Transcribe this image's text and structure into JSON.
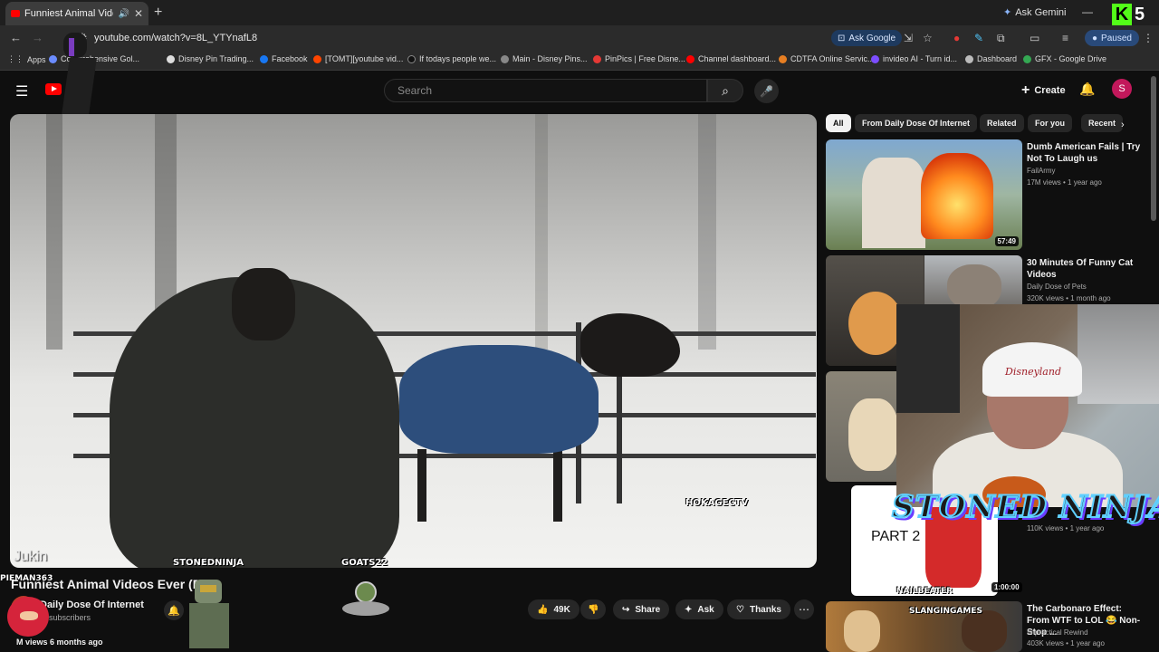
{
  "browser": {
    "tab_title": "Funniest Animal Videos Eve",
    "new_tab": "+",
    "ask_gemini": "Ask Gemini",
    "url": "youtube.com/watch?v=8L_YTYnafL8",
    "ask_google": "Ask Google",
    "profile_status": "Paused",
    "kick_number": "5",
    "bookmarks": [
      "Apps",
      "Comprehensive Gol...",
      "Disney Pin Trading...",
      "Facebook",
      "[TOMT][youtube vid...",
      "If todays people we...",
      "Main - Disney Pins...",
      "PinPics | Free Disne...",
      "Channel dashboard...",
      "CDTFA Online Servic...",
      "invideo AI - Turn id...",
      "Dashboard",
      "GFX - Google Drive"
    ]
  },
  "youtube": {
    "search_placeholder": "Search",
    "create_label": "Create",
    "avatar_letter": "S"
  },
  "video": {
    "title": "Funniest Animal Videos Ever (Part",
    "channel": "Daily Dose Of Internet",
    "subscribers": "M subscribers",
    "views_date": "M views  6 months ago",
    "watermarks": {
      "jukin": "Jukin",
      "stonedninja": "STONEDNINJA",
      "goats": "GOATS22",
      "hokage": "HOKAGECTV"
    },
    "overlay_name": "PIEMAN363",
    "actions": {
      "likes": "49K",
      "share": "Share",
      "ask": "Ask",
      "thanks": "Thanks"
    }
  },
  "sidebar": {
    "chips": [
      "All",
      "From Daily Dose Of Internet",
      "Related",
      "For you",
      "Recent"
    ],
    "recommendations": [
      {
        "title": "Dumb American Fails | Try Not To Laugh us",
        "channel": "FailArmy",
        "meta": "17M views • 1 year ago",
        "duration": "57:49"
      },
      {
        "title": "30 Minutes Of Funny Cat Videos",
        "channel": "Daily Dose of Pets",
        "meta": "320K views • 1 month ago",
        "duration": ""
      },
      {
        "title": "",
        "channel": "",
        "meta": "",
        "duration": ""
      },
      {
        "title": "",
        "channel": "",
        "meta": "110K views • 1 year ago",
        "duration": "1:00:00",
        "thumb_text": "PART 2",
        "thumb_tag": "NAILBEATER"
      },
      {
        "title": "The Carbonaro Effect: From WTF to LOL 😂 Non-Stop ...",
        "channel": "Impractical Rewind",
        "meta": "403K views • 1 year ago",
        "duration": "",
        "thumb_tag": "SLANGINGAMES"
      }
    ]
  },
  "webcam": {
    "cap_text": "Disneyland",
    "banner": "STONED NINJA"
  },
  "colors": {
    "youtube_red": "#ff0000",
    "kick_green": "#53fc18",
    "avatar_bg": "#c2185b",
    "blanket_blue": "#2d4e7c"
  }
}
